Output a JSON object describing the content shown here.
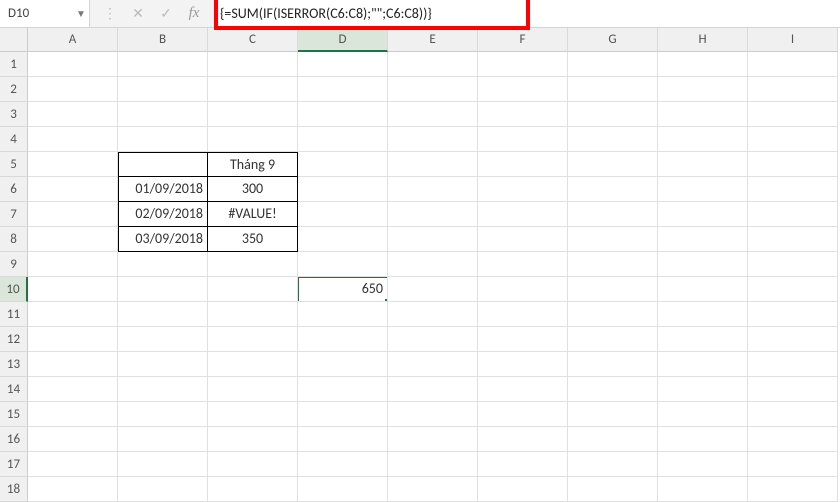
{
  "name_box": "D10",
  "formula": "{=SUM(IF(ISERROR(C6:C8);\"\";C6:C8))}",
  "columns": [
    "A",
    "B",
    "C",
    "D",
    "E",
    "F",
    "G",
    "H",
    "I"
  ],
  "active_col": "D",
  "active_row": 10,
  "active_cell_value": "650",
  "row_count": 18,
  "table": {
    "header": "Tháng 9",
    "rows": [
      {
        "date": "01/09/2018",
        "value": "300"
      },
      {
        "date": "02/09/2018",
        "value": "#VALUE!"
      },
      {
        "date": "03/09/2018",
        "value": "350"
      }
    ]
  },
  "icons": {
    "dots": "⋮",
    "cancel": "✕",
    "enter": "✓",
    "fx": "fx"
  }
}
